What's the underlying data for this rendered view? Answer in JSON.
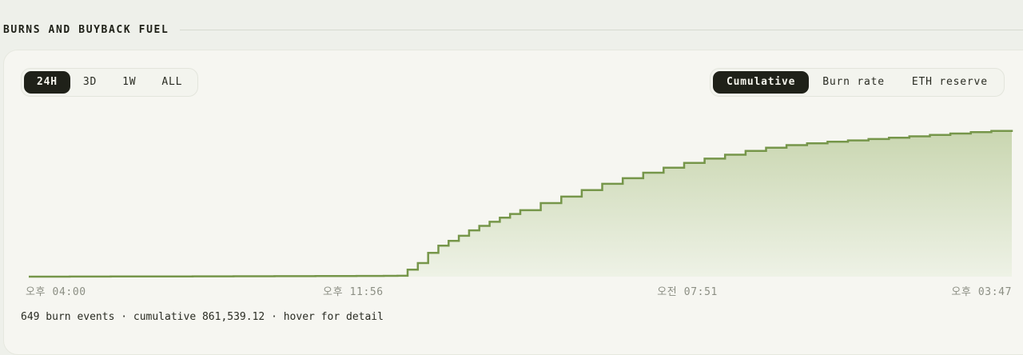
{
  "section": {
    "title": "BURNS AND BUYBACK FUEL"
  },
  "range_tabs": [
    {
      "label": "24H",
      "active": true
    },
    {
      "label": "3D",
      "active": false
    },
    {
      "label": "1W",
      "active": false
    },
    {
      "label": "ALL",
      "active": false
    }
  ],
  "view_tabs": [
    {
      "label": "Cumulative",
      "active": true
    },
    {
      "label": "Burn rate",
      "active": false
    },
    {
      "label": "ETH reserve",
      "active": false
    }
  ],
  "colors": {
    "line": "#76964a",
    "fill_top": "#c9d6b0",
    "fill_bottom": "#eef2e6",
    "active_tab_bg": "#1f2119"
  },
  "footer": {
    "text": "649 burn events · cumulative 861,539.12 · hover for detail"
  },
  "chart_data": {
    "type": "area",
    "step": true,
    "x_tick_labels": [
      "오후 04:00",
      "오후 11:56",
      "오전 07:51",
      "오후 03:47"
    ],
    "x_tick_positions": [
      0,
      0.33,
      0.67,
      1
    ],
    "x": [
      0,
      0.0417,
      0.0833,
      0.125,
      0.1667,
      0.2083,
      0.25,
      0.2917,
      0.3333,
      0.3611,
      0.375,
      0.3854,
      0.3958,
      0.4063,
      0.4167,
      0.4271,
      0.4375,
      0.4479,
      0.4583,
      0.4688,
      0.4792,
      0.4896,
      0.5,
      0.5208,
      0.5417,
      0.5625,
      0.5833,
      0.6042,
      0.625,
      0.6458,
      0.6667,
      0.6875,
      0.7083,
      0.7292,
      0.75,
      0.7708,
      0.7917,
      0.8125,
      0.8333,
      0.8542,
      0.875,
      0.8958,
      0.9167,
      0.9375,
      0.9583,
      0.9792,
      1.0
    ],
    "values": [
      0,
      500,
      1000,
      1500,
      2000,
      2500,
      3000,
      3500,
      4000,
      4500,
      5000,
      41000,
      80000,
      140000,
      182000,
      210000,
      240000,
      272000,
      298000,
      322000,
      346000,
      368000,
      390000,
      432000,
      470000,
      508000,
      545000,
      578000,
      610000,
      640000,
      668000,
      693000,
      716000,
      738000,
      757000,
      772000,
      783000,
      792000,
      800000,
      808000,
      816000,
      824000,
      832000,
      840000,
      848000,
      855000,
      861539.12
    ],
    "ylim": [
      0,
      920000
    ],
    "grid": false
  }
}
